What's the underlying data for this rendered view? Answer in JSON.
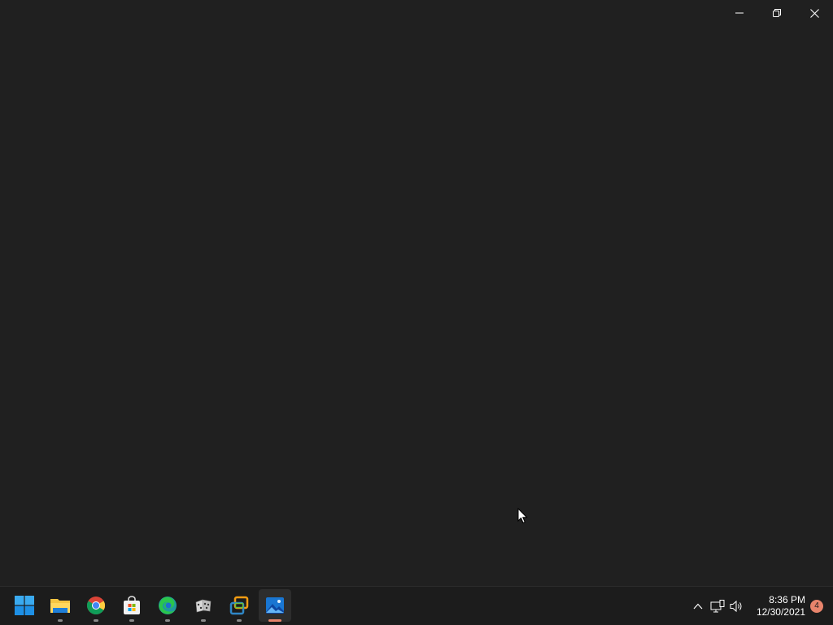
{
  "window": {
    "caption_buttons": [
      {
        "name": "minimize",
        "icon": "minimize-icon"
      },
      {
        "name": "restore",
        "icon": "restore-icon"
      },
      {
        "name": "close",
        "icon": "close-icon"
      }
    ]
  },
  "taskbar": {
    "apps": [
      {
        "name": "start",
        "icon": "windows-start-icon",
        "running": false
      },
      {
        "name": "file-explorer",
        "icon": "folder-icon",
        "running": true
      },
      {
        "name": "chrome",
        "icon": "chrome-icon",
        "running": true
      },
      {
        "name": "microsoft-store",
        "icon": "store-bag-icon",
        "running": true
      },
      {
        "name": "edge",
        "icon": "edge-icon",
        "running": true
      },
      {
        "name": "dice-app",
        "icon": "dice-icon",
        "running": true
      },
      {
        "name": "vmware",
        "icon": "vmware-icon",
        "running": true
      },
      {
        "name": "photos",
        "icon": "photos-icon",
        "running": true,
        "active": true
      }
    ],
    "tray": {
      "icons": [
        "chevron-up-icon",
        "network-icon",
        "volume-icon"
      ],
      "time": "8:36 PM",
      "date": "12/30/2021",
      "notification_count": "4"
    }
  },
  "colors": {
    "background": "#202020",
    "taskbar": "#1c1c1c",
    "accent": "#e8846c"
  }
}
